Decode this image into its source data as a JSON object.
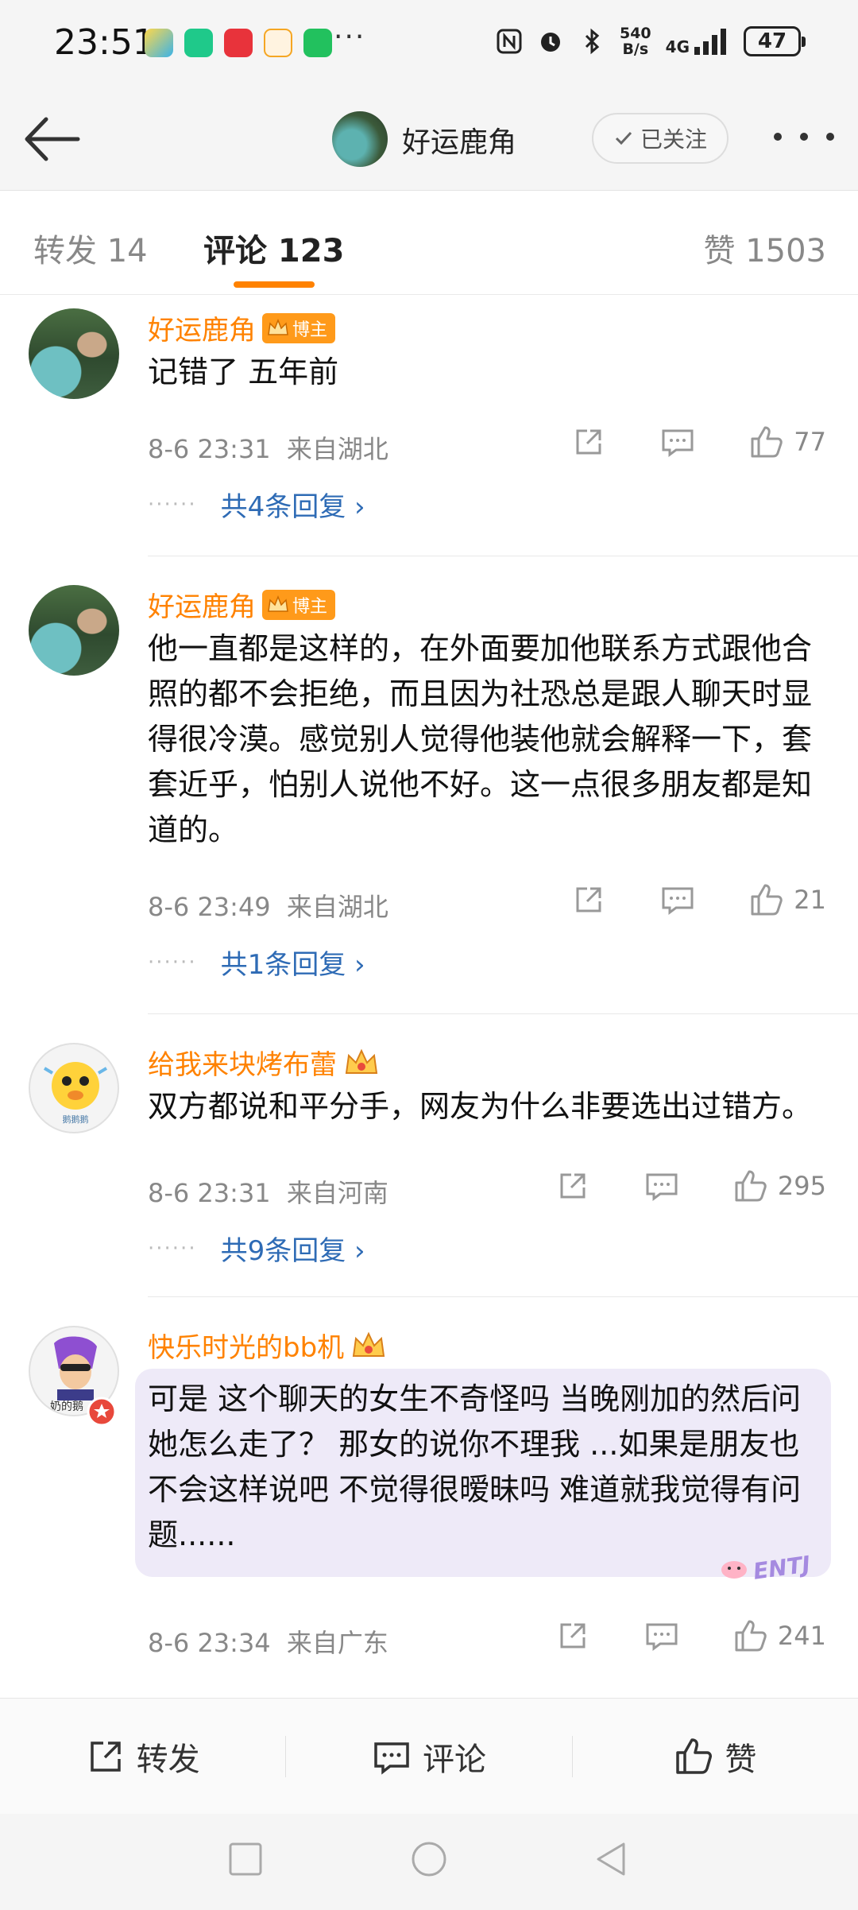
{
  "status_bar": {
    "time": "23:51",
    "dots": "···",
    "net_speed_value": "540",
    "net_speed_unit": "B/s",
    "network": "4G",
    "battery": "47"
  },
  "header": {
    "title": "好运鹿角",
    "follow_label": "已关注"
  },
  "tabs": {
    "forward": "转发 14",
    "comments": "评论 123",
    "likes": "赞 1503"
  },
  "comments": [
    {
      "author": "好运鹿角",
      "badge": "博主",
      "text": "记错了 五年前",
      "time": "8-6 23:31",
      "location": "来自湖北",
      "likes": "77",
      "replies": "共4条回复 ›"
    },
    {
      "author": "好运鹿角",
      "badge": "博主",
      "text": "他一直都是这样的，在外面要加他联系方式跟他合照的都不会拒绝，而且因为社恐总是跟人聊天时显得很冷漠。感觉别人觉得他装他就会解释一下，套套近乎，怕别人说他不好。这一点很多朋友都是知道的。",
      "time": "8-6 23:49",
      "location": "来自湖北",
      "likes": "21",
      "replies": "共1条回复 ›"
    },
    {
      "author": "给我来块烤布蕾",
      "text": "双方都说和平分手，网友为什么非要选出过错方。",
      "time": "8-6 23:31",
      "location": "来自河南",
      "likes": "295",
      "replies": "共9条回复 ›",
      "avatar_caption": "鹅鹅鹅"
    },
    {
      "author": "快乐时光的bb机",
      "text": "可是 这个聊天的女生不奇怪吗 当晚刚加的然后问她怎么走了？ 那女的说你不理我 ...如果是朋友也不会这样说吧 不觉得很暧昧吗 难道就我觉得有问题......",
      "time": "8-6 23:34",
      "location": "来自广东",
      "likes": "241",
      "bubble_tag": "ENTJ",
      "avatar_caption": "奶的鹅"
    }
  ],
  "toolbar": {
    "forward": "转发",
    "comment": "评论",
    "like": "赞"
  },
  "colors": {
    "accent": "#ff8200",
    "link": "#2e6bb5",
    "meta": "#888888",
    "bubble": "#eeeaf8"
  }
}
